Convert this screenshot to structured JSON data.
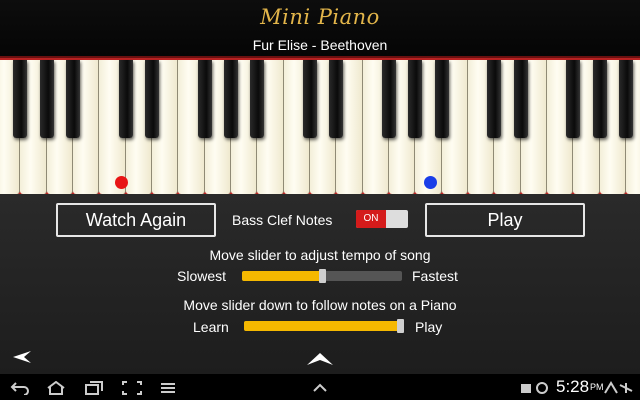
{
  "app": {
    "title": "Mini Piano",
    "song": "Fur Elise - Beethoven"
  },
  "keyboard": {
    "highlighted_keys": [
      {
        "color": "#e81414",
        "note": "red"
      },
      {
        "color": "#1a3ee8",
        "note": "blue"
      }
    ]
  },
  "controls": {
    "watch_again_label": "Watch Again",
    "bass_clef_label": "Bass Clef Notes",
    "bass_clef_toggle": "ON",
    "play_label": "Play",
    "tempo_instruction": "Move slider to adjust tempo of song",
    "tempo_min_label": "Slowest",
    "tempo_max_label": "Fastest",
    "tempo_value": 0.5,
    "mode_instruction": "Move slider down to follow notes on a Piano",
    "mode_min_label": "Learn",
    "mode_max_label": "Play",
    "mode_value": 1.0
  },
  "system_bar": {
    "time": "5:28",
    "ampm": "PM"
  },
  "colors": {
    "accent": "#f5b800",
    "title_gold": "#e2b54a",
    "toggle_red": "#d41b1b"
  }
}
